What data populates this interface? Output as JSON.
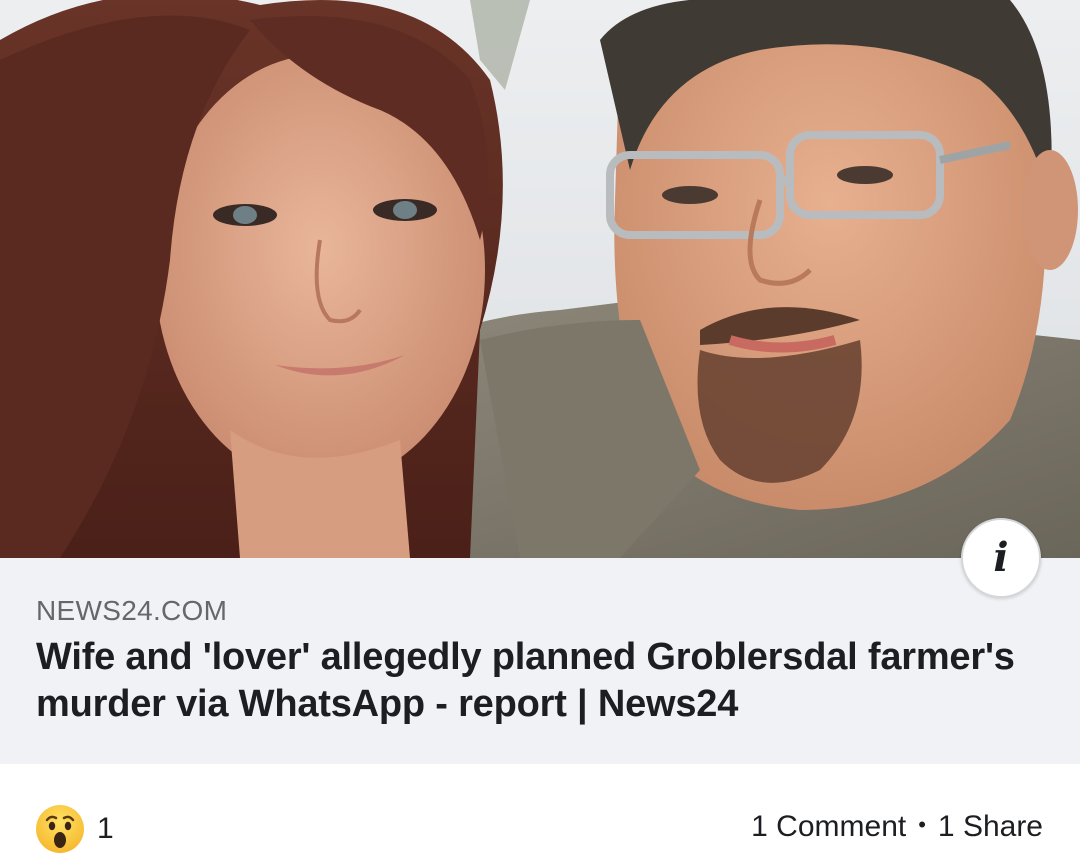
{
  "link_preview": {
    "image_alt": "Couple selfie photo",
    "domain": "NEWS24.COM",
    "title": "Wife and 'lover' allegedly planned Groblersdal farmer's murder via WhatsApp - report | News24",
    "info_icon": "info-icon"
  },
  "reactions": {
    "icon": "wow-reaction-icon",
    "count": "1"
  },
  "stats": {
    "comments": "1 Comment",
    "separator": "•",
    "shares": "1 Share"
  },
  "colors": {
    "meta_background": "#f0f2f5",
    "domain_text": "#65676b",
    "title_text": "#1c1e21"
  }
}
